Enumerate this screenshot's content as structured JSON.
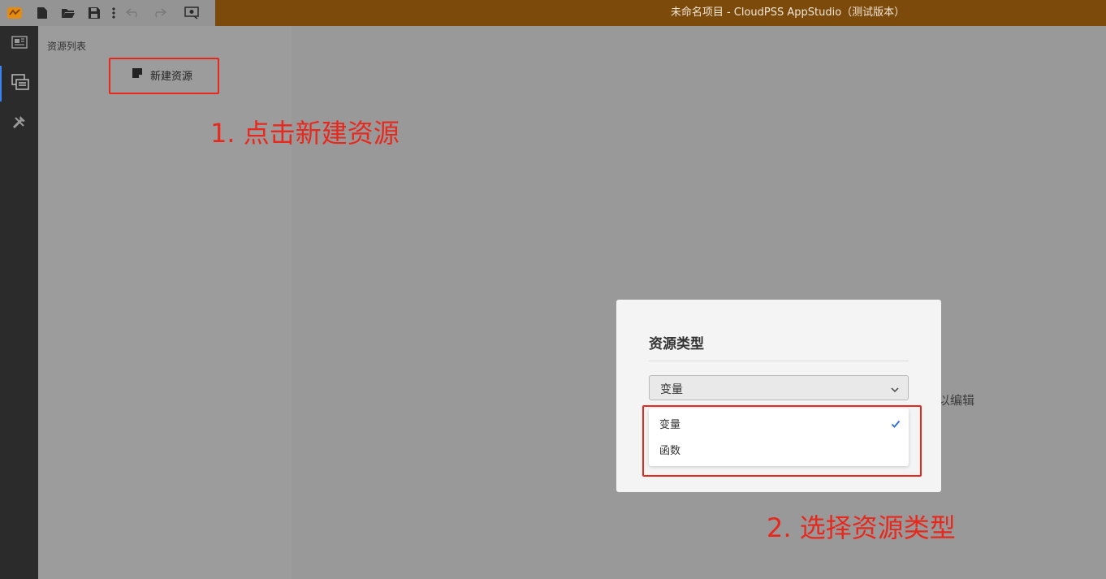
{
  "window": {
    "title": "未命名项目 - CloudPSS AppStudio（测试版本）",
    "accent_color": "#7c4a0b",
    "toolbar_icons": [
      "app-logo-icon",
      "new-file-icon",
      "open-folder-icon",
      "save-icon",
      "more-vert-icon",
      "undo-icon",
      "redo-icon",
      "preview-icon"
    ]
  },
  "rail": {
    "items": [
      {
        "icon": "layout-icon",
        "active": false
      },
      {
        "icon": "resources-icon",
        "active": true
      },
      {
        "icon": "tools-icon",
        "active": false
      }
    ]
  },
  "panel": {
    "title": "资源列表",
    "new_button_label": "新建资源"
  },
  "background": {
    "hint_text_fragment": "以编辑"
  },
  "dialog": {
    "title": "资源类型",
    "select_value": "变量",
    "options": [
      {
        "label": "变量",
        "selected": true
      },
      {
        "label": "函数",
        "selected": false
      }
    ]
  },
  "annotations": {
    "step1": "1. 点击新建资源",
    "step2": "2. 选择资源类型",
    "color": "#e8281d"
  }
}
